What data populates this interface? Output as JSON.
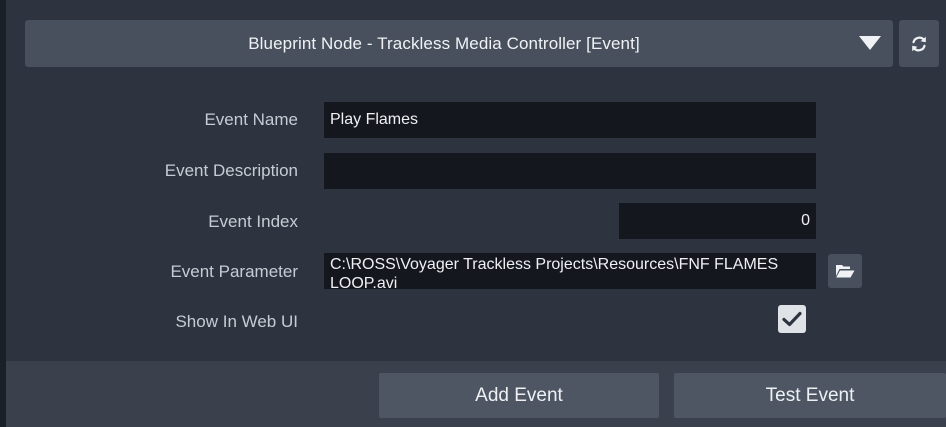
{
  "header": {
    "title": "Blueprint Node - Trackless Media Controller [Event]",
    "dropdown_icon": "chevron-down-icon",
    "refresh_icon": "refresh-icon"
  },
  "form": {
    "event_name": {
      "label": "Event Name",
      "value": "Play Flames"
    },
    "event_description": {
      "label": "Event Description",
      "value": ""
    },
    "event_index": {
      "label": "Event Index",
      "value": "0"
    },
    "event_parameter": {
      "label": "Event Parameter",
      "value": "C:\\ROSS\\Voyager Trackless Projects\\Resources\\FNF FLAMES LOOP.avi",
      "browse_icon": "folder-open-icon"
    },
    "show_in_web_ui": {
      "label": "Show In Web UI",
      "checked": true
    }
  },
  "footer": {
    "add_event_label": "Add Event",
    "test_event_label": "Test Event"
  },
  "colors": {
    "panel_bg": "#2e343f",
    "header_bg": "#48505d",
    "field_bg": "#14181e",
    "footer_bg": "#3a414c",
    "button_bg": "#4e5664",
    "text": "#f0f2f5",
    "label_text": "#c7ccd4"
  }
}
